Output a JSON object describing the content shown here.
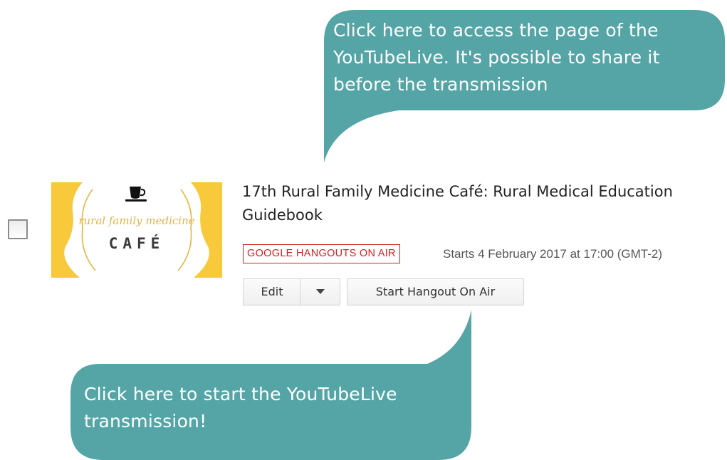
{
  "callouts": {
    "top": {
      "text": "Click here to access the page of the\nYouTubeLive. It's possible to share it\nbefore the transmission",
      "color": "#56a5a6"
    },
    "bottom": {
      "text": "Click here to start the YouTubeLive\ntransmission!",
      "color": "#56a5a6"
    }
  },
  "video": {
    "thumbnail": {
      "script_text": "rural family medicine",
      "cafe_text": "CAFÉ",
      "accent_color": "#f8c93a",
      "icon": "coffee-cup-icon"
    },
    "title": "17th Rural Family Medicine Café: Rural Medical Education Guidebook",
    "badge": "GOOGLE HANGOUTS ON AIR",
    "badge_color": "#cc2222",
    "start_time": "Starts 4 February 2017 at 17:00 (GMT-2)",
    "actions": {
      "edit_label": "Edit",
      "dropdown_icon": "chevron-down-icon",
      "start_label": "Start Hangout On Air"
    }
  }
}
